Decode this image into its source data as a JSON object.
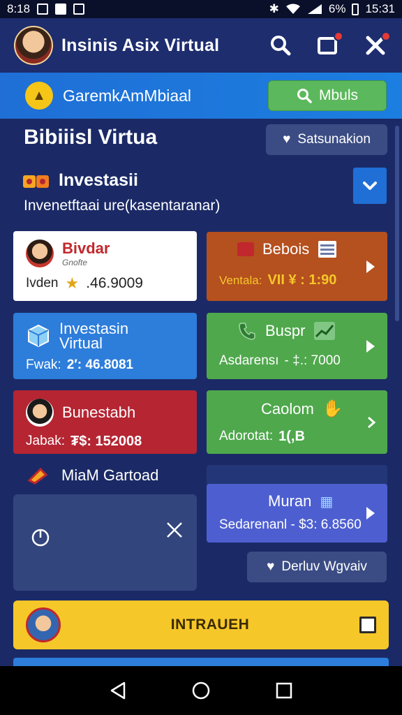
{
  "status": {
    "time": "8:18",
    "battery": "6%",
    "clock": "15:31"
  },
  "appbar": {
    "title": "Insinis Asix Virtual"
  },
  "banner": {
    "title": "GaremkAmMbiaal",
    "button_label": "Mbuls"
  },
  "section": {
    "title": "Bibiiisl Virtua",
    "pill_label": "Satsunakion"
  },
  "invest": {
    "label": "Investasii",
    "subtitle": "Invenetftaai ure(kasentaranar)"
  },
  "cards": {
    "c1": {
      "title": "Bivdar",
      "subtitle": "Gnofte",
      "value_label": "Ivden",
      "value": ".46.9009"
    },
    "c2": {
      "title": "Bebois",
      "value_label": "Ventala:",
      "value": "VII ¥ : 1:90"
    },
    "c3": {
      "title": "Investasin Virtual",
      "value_label": "Fwak:",
      "value": "2′: 46.8081"
    },
    "c4": {
      "title": "Buspr",
      "value_label": "Asdarensı",
      "value": "- ‡.: 7000"
    },
    "c5": {
      "title": "Bunestabh",
      "value_label": "Jabak:",
      "value": "₮$: 152008"
    },
    "c6": {
      "title": "Caolom",
      "value_label": "Adorotat:",
      "value": "1(,B"
    }
  },
  "marker": {
    "label": "MiaM Gartoad"
  },
  "indigo_card": {
    "title": "Muran",
    "value": "Sedarenanl - $3: 6.8560"
  },
  "pill2": {
    "label": "Derluv Wgvaiv"
  },
  "yellow_bar": {
    "label": "INTRAUEH"
  },
  "colors": {
    "primary": "#1f6fd6",
    "accent_green": "#5cb85c",
    "accent_yellow": "#f6c729",
    "background": "#1b2a66"
  }
}
